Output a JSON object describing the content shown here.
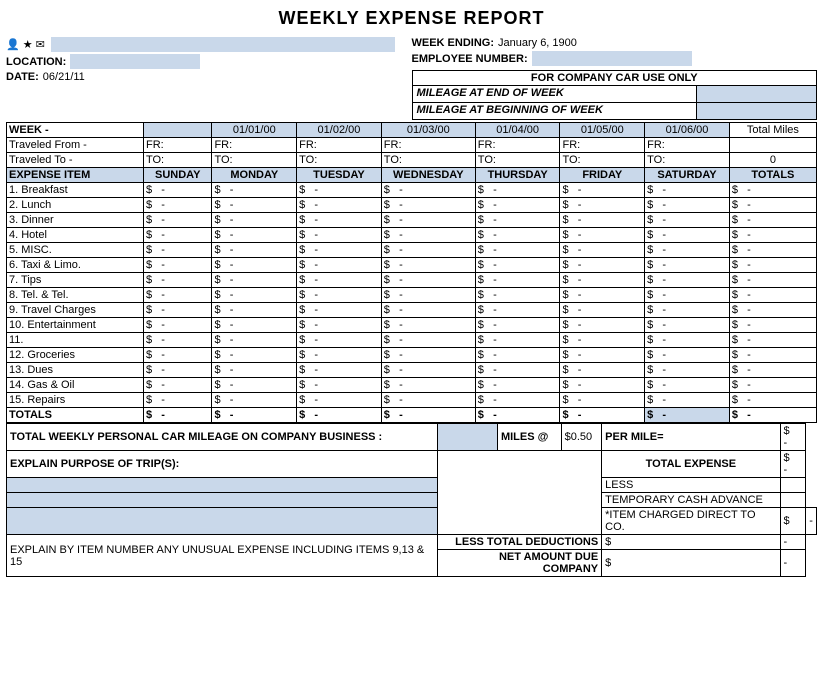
{
  "title": "WEEKLY EXPENSE REPORT",
  "header": {
    "week_ending_label": "WEEK ENDING:",
    "week_ending_value": "January 6, 1900",
    "employee_number_label": "EMPLOYEE NUMBER:",
    "location_label": "LOCATION:",
    "date_label": "DATE:",
    "date_value": "06/21/11",
    "for_company_label": "FOR COMPANY CAR USE ONLY",
    "mileage_end_label": "MILEAGE AT END OF WEEK",
    "mileage_begin_label": "MILEAGE AT BEGINNING OF WEEK"
  },
  "week_row": {
    "week_label": "WEEK -",
    "dates": [
      "01/01/00",
      "01/02/00",
      "01/03/00",
      "01/04/00",
      "01/05/00",
      "01/06/00"
    ],
    "total_miles_label": "Total Miles",
    "total_miles_value": "0"
  },
  "travel_row": {
    "from_label": "Traveled From -",
    "to_label": "Traveled To -",
    "fr": "FR:",
    "to": "TO:"
  },
  "columns": {
    "expense_item": "EXPENSE ITEM",
    "sunday": "SUNDAY",
    "monday": "MONDAY",
    "tuesday": "TUESDAY",
    "wednesday": "WEDNESDAY",
    "thursday": "THURSDAY",
    "friday": "FRIDAY",
    "saturday": "SATURDAY",
    "totals": "TOTALS"
  },
  "expense_items": [
    "1. Breakfast",
    "2. Lunch",
    "3. Dinner",
    "4. Hotel",
    "5. MISC.",
    "6. Taxi & Limo.",
    "7. Tips",
    "8. Tel. & Tel.",
    "9. Travel Charges",
    "10. Entertainment",
    "11.",
    "12. Groceries",
    "13. Dues",
    "14. Gas & Oil",
    "15. Repairs",
    "TOTALS"
  ],
  "bottom": {
    "mileage_label": "TOTAL WEEKLY PERSONAL CAR MILEAGE ON COMPANY BUSINESS :",
    "miles_at_label": "MILES @",
    "miles_at_value": "$0.50",
    "per_mile_label": "PER MILE=",
    "explain_label": "EXPLAIN PURPOSE OF TRIP(S):",
    "total_expense_label": "TOTAL EXPENSE",
    "less_label": "LESS",
    "temp_advance_label": "TEMPORARY CASH ADVANCE",
    "item_charged_label": "*ITEM CHARGED DIRECT TO CO.",
    "less_total_label": "LESS TOTAL DEDUCTIONS",
    "net_amount_label": "NET AMOUNT DUE COMPANY",
    "explain_unusual_label": "EXPLAIN BY ITEM NUMBER ANY UNUSUAL EXPENSE INCLUDING ITEMS 9,13 & 15"
  }
}
